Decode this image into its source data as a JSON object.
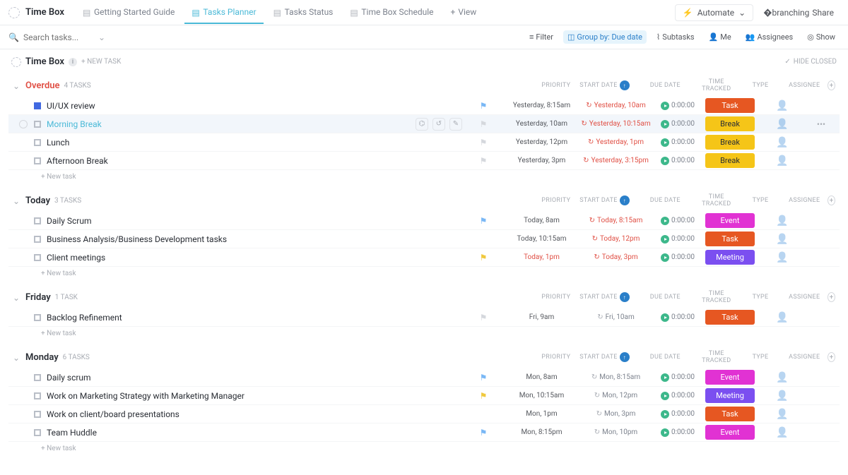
{
  "space": {
    "title": "Time Box"
  },
  "tabs": [
    {
      "label": "Getting Started Guide",
      "ico": "doc"
    },
    {
      "label": "Tasks Planner",
      "ico": "list",
      "active": true
    },
    {
      "label": "Tasks Status",
      "ico": "list"
    },
    {
      "label": "Time Box Schedule",
      "ico": "cal"
    }
  ],
  "add_view": "View",
  "automate": "Automate",
  "share": "Share",
  "search_placeholder": "Search tasks...",
  "toolbar": {
    "filter": "Filter",
    "group_by": "Group by: Due date",
    "subtasks": "Subtasks",
    "me": "Me",
    "assignees": "Assignees",
    "show": "Show"
  },
  "list": {
    "title": "Time Box",
    "new_task": "+ NEW TASK",
    "hide_closed": "HIDE CLOSED"
  },
  "columns": {
    "priority": "PRIORITY",
    "start": "START DATE",
    "due": "DUE DATE",
    "tracked": "TIME TRACKED",
    "type": "TYPE",
    "assignee": "ASSIGNEE"
  },
  "new_task_row": "+ New task",
  "groups": [
    {
      "title": "Overdue",
      "overdue": true,
      "count": "4 TASKS",
      "tasks": [
        {
          "name": "UI/UX review",
          "status": "blue",
          "flag": "blue",
          "start": "Yesterday, 8:15am",
          "due": "Yesterday, 10am",
          "due_repeat": true,
          "tracked": "0:00:00",
          "type": "Task",
          "type_class": "task"
        },
        {
          "name": "Morning Break",
          "hover": true,
          "active": true,
          "flag": "grey",
          "start": "Yesterday, 10am",
          "due": "Yesterday, 10:15am",
          "due_repeat": true,
          "tracked": "0:00:00",
          "type": "Break",
          "type_class": "break-b",
          "show_actions": true,
          "show_more": true,
          "show_check": true
        },
        {
          "name": "Lunch",
          "flag": "grey",
          "start": "Yesterday, 12pm",
          "due": "Yesterday, 1pm",
          "due_repeat": true,
          "tracked": "0:00:00",
          "type": "Break",
          "type_class": "break-b"
        },
        {
          "name": "Afternoon Break",
          "flag": "grey",
          "start": "Yesterday, 3pm",
          "due": "Yesterday, 3:15pm",
          "due_repeat": true,
          "tracked": "0:00:00",
          "type": "Break",
          "type_class": "break-b"
        }
      ]
    },
    {
      "title": "Today",
      "count": "3 TASKS",
      "tasks": [
        {
          "name": "Daily Scrum",
          "flag": "blue",
          "start": "Today, 8am",
          "due": "Today, 8:15am",
          "due_repeat": true,
          "tracked": "0:00:00",
          "type": "Event",
          "type_class": "event"
        },
        {
          "name": "Business Analysis/Business Development tasks",
          "start": "Today, 10:15am",
          "due": "Today, 12pm",
          "due_repeat": true,
          "tracked": "0:00:00",
          "type": "Task",
          "type_class": "task"
        },
        {
          "name": "Client meetings",
          "flag": "yellow",
          "start": "Today, 1pm",
          "start_red": true,
          "due": "Today, 3pm",
          "due_repeat": true,
          "tracked": "0:00:00",
          "type": "Meeting",
          "type_class": "meeting"
        }
      ]
    },
    {
      "title": "Friday",
      "count": "1 TASK",
      "tasks": [
        {
          "name": "Backlog Refinement",
          "flag": "grey",
          "start": "Fri, 9am",
          "due": "Fri, 10am",
          "due_normal": true,
          "due_repeat_grey": true,
          "tracked": "0:00:00",
          "type": "Task",
          "type_class": "task"
        }
      ]
    },
    {
      "title": "Monday",
      "count": "6 TASKS",
      "tasks": [
        {
          "name": "Daily scrum",
          "flag": "blue",
          "start": "Mon, 8am",
          "due": "Mon, 8:15am",
          "due_normal": true,
          "due_repeat_grey": true,
          "tracked": "0:00:00",
          "type": "Event",
          "type_class": "event"
        },
        {
          "name": "Work on Marketing Strategy with Marketing Manager",
          "flag": "yellow",
          "start": "Mon, 10:15am",
          "due": "Mon, 12pm",
          "due_normal": true,
          "due_repeat_grey": true,
          "tracked": "0:00:00",
          "type": "Meeting",
          "type_class": "meeting"
        },
        {
          "name": "Work on client/board presentations",
          "start": "Mon, 1pm",
          "due": "Mon, 3pm",
          "due_normal": true,
          "due_repeat_grey": true,
          "tracked": "0:00:00",
          "type": "Task",
          "type_class": "task"
        },
        {
          "name": "Team Huddle",
          "flag": "blue",
          "start": "Mon, 8:15pm",
          "due": "Mon, 10pm",
          "due_normal": true,
          "due_repeat_grey": true,
          "tracked": "0:00:00",
          "type": "Event",
          "type_class": "event"
        }
      ]
    }
  ]
}
